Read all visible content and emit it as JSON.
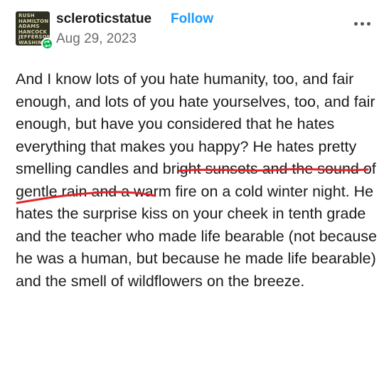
{
  "post": {
    "avatar_lines": "RUSH\nHAMILTON\nADAMS\nHANCOCK\nJEFFERSON\nWASHING\nWASHINGTON",
    "username": "scleroticstatue",
    "follow_label": "Follow",
    "date": "Aug 29, 2023",
    "text": {
      "part1": "And I know lots of you hate humanity, too, and fair enough, and lots of you hate yourselves, too, and fair enough, but have you considered that ",
      "highlight": "he hates everything that makes you happy",
      "part2": "? He hates pretty smelling candles and bright sunsets and the sound of gentle rain and a warm fire on a cold winter night. He hates the surprise kiss on your cheek in tenth grade and the teacher who made life bearable (not because he was a human, but because he made life bearable) and the smell of wildflowers on the breeze."
    }
  },
  "colors": {
    "follow": "#1a9cff",
    "reblog_badge": "#00b34d",
    "underline": "#e0262b",
    "meta_text": "#6b6b6b"
  },
  "icons": {
    "reblog": "reblog-icon",
    "more": "more-options-icon"
  }
}
